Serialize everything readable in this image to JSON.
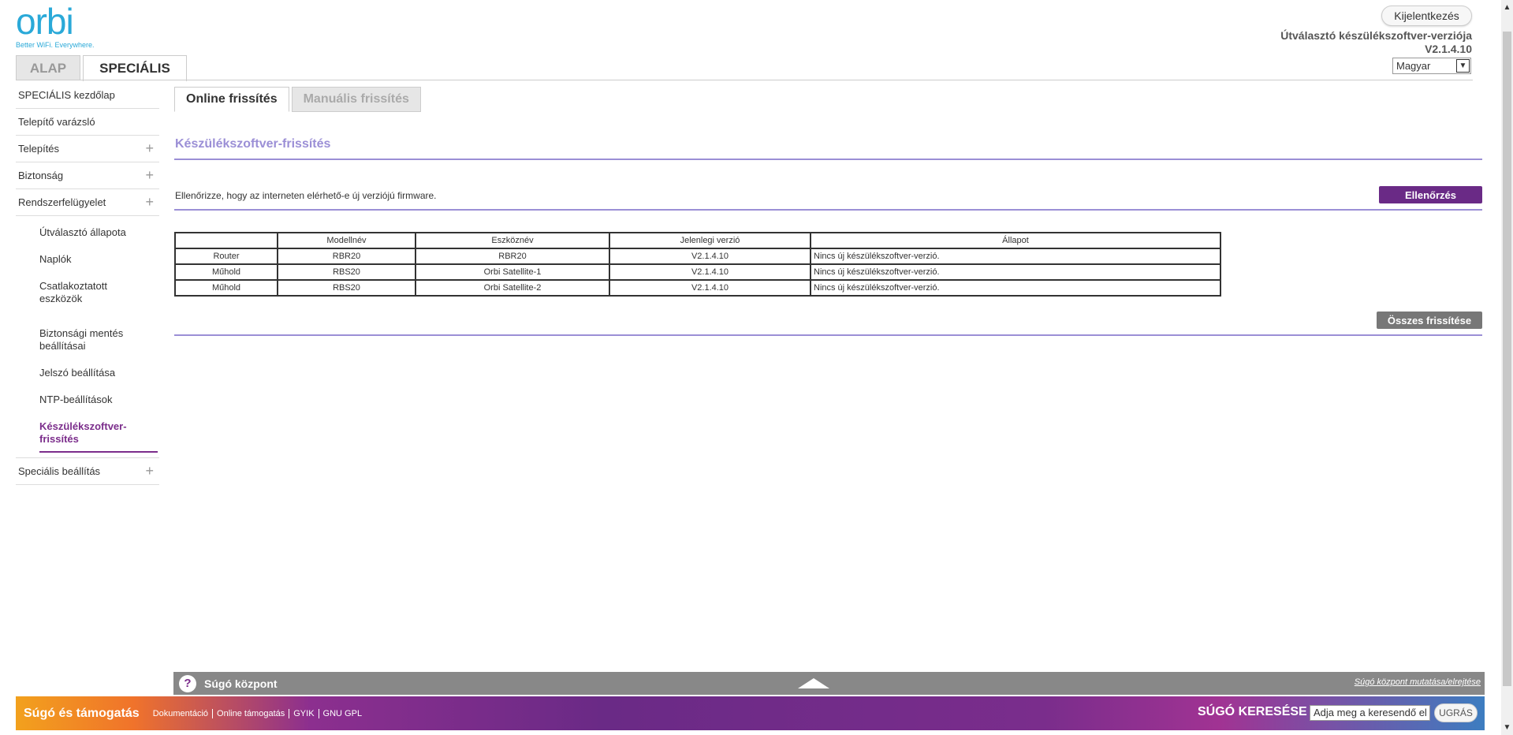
{
  "logo": {
    "text": "orbi",
    "tagline": "Better WiFi. Everywhere."
  },
  "header": {
    "logout_label": "Kijelentkezés",
    "fw_version_label": "Útválasztó készülékszoftver-verziója",
    "fw_version": "V2.1.4.10",
    "language": "Magyar"
  },
  "top_tabs": [
    {
      "label": "ALAP",
      "active": false
    },
    {
      "label": "SPECIÁLIS",
      "active": true
    }
  ],
  "sidebar": {
    "items": [
      {
        "label": "SPECIÁLIS kezdőlap"
      },
      {
        "label": "Telepítő varázsló"
      },
      {
        "label": "Telepítés",
        "expand": "+"
      },
      {
        "label": "Biztonság",
        "expand": "+"
      },
      {
        "label": "Rendszerfelügyelet",
        "expand": "+"
      }
    ],
    "sub_items": [
      {
        "label": "Útválasztó állapota"
      },
      {
        "label": "Naplók"
      },
      {
        "label": "Csatlakoztatott eszközök"
      },
      {
        "label": "Biztonsági mentés beállításai"
      },
      {
        "label": "Jelszó beállítása"
      },
      {
        "label": "NTP-beállítások"
      },
      {
        "label": "Készülékszoftver-frissítés",
        "active": true
      }
    ],
    "last_item": {
      "label": "Speciális beállítás",
      "expand": "+"
    }
  },
  "sub_tabs": [
    {
      "label": "Online frissítés",
      "active": true
    },
    {
      "label": "Manuális frissítés",
      "active": false
    }
  ],
  "main": {
    "section_title": "Készülékszoftver-frissítés",
    "description": "Ellenőrizze, hogy az interneten elérhető-e új verziójú firmware.",
    "check_button": "Ellenőrzés",
    "update_all_button": "Összes frissítése"
  },
  "table": {
    "headers": [
      "",
      "Modellnév",
      "Eszköznév",
      "Jelenlegi verzió",
      "Állapot"
    ],
    "rows": [
      [
        "Router",
        "RBR20",
        "RBR20",
        "V2.1.4.10",
        "Nincs új készülékszoftver-verzió."
      ],
      [
        "Műhold",
        "RBS20",
        "Orbi Satellite-1",
        "V2.1.4.10",
        "Nincs új készülékszoftver-verzió."
      ],
      [
        "Műhold",
        "RBS20",
        "Orbi Satellite-2",
        "V2.1.4.10",
        "Nincs új készülékszoftver-verzió."
      ]
    ]
  },
  "help_bar": {
    "icon": "?",
    "title": "Súgó központ",
    "toggle_link": "Súgó központ mutatása/elrejtése"
  },
  "footer": {
    "title": "Súgó és támogatás",
    "links": [
      "Dokumentáció",
      "Online támogatás",
      "GYIK",
      "GNU GPL"
    ],
    "search_label": "SÚGÓ KERESÉSE",
    "search_value": "Adja meg a keresendő el",
    "go_button": "UGRÁS"
  },
  "colors": {
    "accent": "#6a2a86",
    "section_title": "#9b8fd6",
    "logo": "#2aa9d8"
  }
}
